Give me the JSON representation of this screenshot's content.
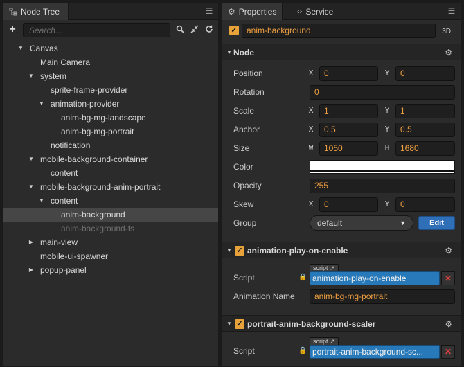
{
  "node_tree": {
    "tab_label": "Node Tree",
    "tab_icon": "hierarchy-icon",
    "search_placeholder": "Search...",
    "nodes": [
      {
        "label": "Canvas",
        "depth": 0,
        "arrow": "expanded"
      },
      {
        "label": "Main Camera",
        "depth": 1,
        "arrow": "none"
      },
      {
        "label": "system",
        "depth": 1,
        "arrow": "expanded"
      },
      {
        "label": "sprite-frame-provider",
        "depth": 2,
        "arrow": "none"
      },
      {
        "label": "animation-provider",
        "depth": 2,
        "arrow": "expanded"
      },
      {
        "label": "anim-bg-mg-landscape",
        "depth": 3,
        "arrow": "none"
      },
      {
        "label": "anim-bg-mg-portrait",
        "depth": 3,
        "arrow": "none"
      },
      {
        "label": "notification",
        "depth": 2,
        "arrow": "none"
      },
      {
        "label": "mobile-background-container",
        "depth": 1,
        "arrow": "expanded"
      },
      {
        "label": "content",
        "depth": 2,
        "arrow": "none"
      },
      {
        "label": "mobile-background-anim-portrait",
        "depth": 1,
        "arrow": "expanded"
      },
      {
        "label": "content",
        "depth": 2,
        "arrow": "expanded"
      },
      {
        "label": "anim-background",
        "depth": 3,
        "arrow": "none",
        "selected": true
      },
      {
        "label": "anim-background-fs",
        "depth": 3,
        "arrow": "none",
        "dim": true
      },
      {
        "label": "main-view",
        "depth": 1,
        "arrow": "collapsed"
      },
      {
        "label": "mobile-ui-spawner",
        "depth": 1,
        "arrow": "none"
      },
      {
        "label": "popup-panel",
        "depth": 1,
        "arrow": "collapsed"
      }
    ]
  },
  "properties": {
    "tab_label": "Properties",
    "service_tab_label": "Service",
    "node_name": "anim-background",
    "node_active": true,
    "mode_badge": "3D",
    "node_section": {
      "title": "Node",
      "position_label": "Position",
      "position_x": "0",
      "position_y": "0",
      "rotation_label": "Rotation",
      "rotation": "0",
      "scale_label": "Scale",
      "scale_x": "1",
      "scale_y": "1",
      "anchor_label": "Anchor",
      "anchor_x": "0.5",
      "anchor_y": "0.5",
      "size_label": "Size",
      "size_w": "1050",
      "size_h": "1680",
      "color_label": "Color",
      "color_value": "#ffffff",
      "opacity_label": "Opacity",
      "opacity": "255",
      "skew_label": "Skew",
      "skew_x": "0",
      "skew_y": "0",
      "group_label": "Group",
      "group_value": "default",
      "edit_label": "Edit",
      "axis_x": "X",
      "axis_y": "Y",
      "axis_w": "W",
      "axis_h": "H"
    },
    "anim_component": {
      "title": "animation-play-on-enable",
      "enabled": true,
      "script_label": "Script",
      "script_tag": "script",
      "script_value": "animation-play-on-enable",
      "anim_name_label": "Animation Name",
      "anim_name_value": "anim-bg-mg-portrait"
    },
    "scaler_component": {
      "title": "portrait-anim-background-scaler",
      "enabled": true,
      "script_label": "Script",
      "script_tag": "script",
      "script_value": "portrait-anim-background-sc..."
    }
  },
  "colors": {
    "accent_orange": "#f0a040",
    "checkbox_orange": "#e8a23a",
    "selection_bg": "#464646",
    "script_blue": "#2779b9",
    "edit_blue": "#2f6fb8",
    "remove_red": "#e04040"
  }
}
